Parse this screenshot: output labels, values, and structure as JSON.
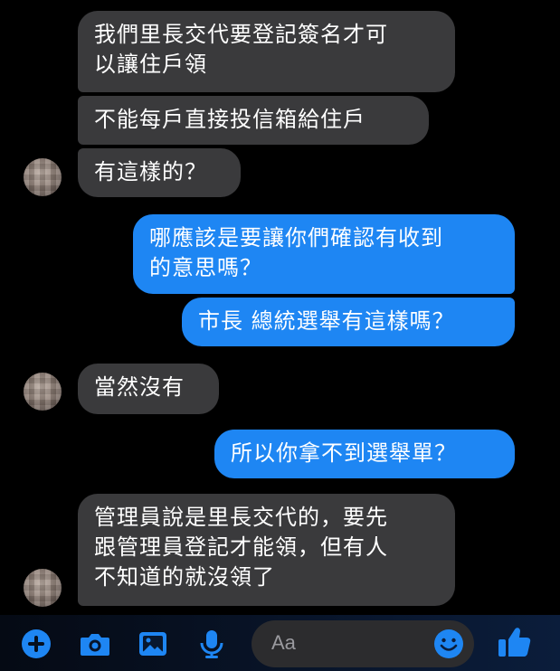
{
  "messages": [
    {
      "text": "我們里長交代要登記簽名才可\n以讓住戶領"
    },
    {
      "text": "不能每戶直接投信箱給住戶"
    },
    {
      "text": "有這樣的？"
    },
    {
      "text": "哪應該是要讓你們確認有收到\n的意思嗎？"
    },
    {
      "text": "市長 總統選舉有這樣嗎？"
    },
    {
      "text": "當然沒有"
    },
    {
      "text": "所以你拿不到選舉單？"
    },
    {
      "text": "管理員說是里長交代的，要先\n跟管理員登記才能領，但有人\n不知道的就沒領了"
    }
  ],
  "composer": {
    "placeholder": "Aa"
  },
  "icons": [
    "plus-icon",
    "camera-icon",
    "image-icon",
    "microphone-icon",
    "emoji-icon",
    "thumbs-up-icon"
  ],
  "colors": {
    "incoming": "#3a3a3c",
    "outgoing": "#1e86f3",
    "accent": "#1e86f3"
  }
}
